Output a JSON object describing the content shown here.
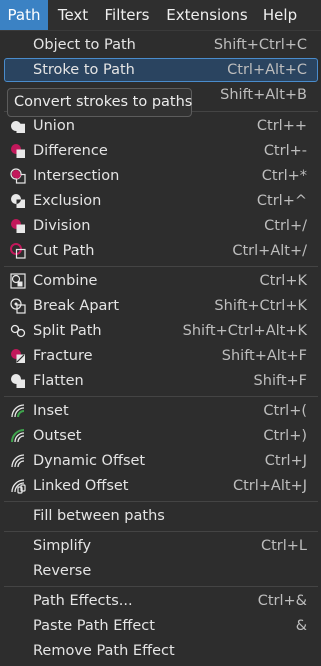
{
  "menubar": {
    "items": [
      "Path",
      "Text",
      "Filters",
      "Extensions",
      "Help"
    ]
  },
  "tooltip": "Convert strokes to paths",
  "menu": {
    "items": [
      {
        "label": "Object to Path",
        "shortcut": "Shift+Ctrl+C",
        "icon": "none"
      },
      {
        "label": "Stroke to Path",
        "shortcut": "Ctrl+Alt+C",
        "icon": "none"
      },
      {
        "label": "",
        "shortcut": "Shift+Alt+B",
        "icon": "none"
      },
      {
        "label": "Union",
        "shortcut": "Ctrl++",
        "icon": "union-icon"
      },
      {
        "label": "Difference",
        "shortcut": "Ctrl+-",
        "icon": "difference-icon"
      },
      {
        "label": "Intersection",
        "shortcut": "Ctrl+*",
        "icon": "intersection-icon"
      },
      {
        "label": "Exclusion",
        "shortcut": "Ctrl+^",
        "icon": "exclusion-icon"
      },
      {
        "label": "Division",
        "shortcut": "Ctrl+/",
        "icon": "division-icon"
      },
      {
        "label": "Cut Path",
        "shortcut": "Ctrl+Alt+/",
        "icon": "cut-path-icon"
      },
      {
        "label": "Combine",
        "shortcut": "Ctrl+K",
        "icon": "combine-icon"
      },
      {
        "label": "Break Apart",
        "shortcut": "Shift+Ctrl+K",
        "icon": "break-apart-icon"
      },
      {
        "label": "Split Path",
        "shortcut": "Shift+Ctrl+Alt+K",
        "icon": "split-path-icon"
      },
      {
        "label": "Fracture",
        "shortcut": "Shift+Alt+F",
        "icon": "fracture-icon"
      },
      {
        "label": "Flatten",
        "shortcut": "Shift+F",
        "icon": "flatten-icon"
      },
      {
        "label": "Inset",
        "shortcut": "Ctrl+(",
        "icon": "inset-icon"
      },
      {
        "label": "Outset",
        "shortcut": "Ctrl+)",
        "icon": "outset-icon"
      },
      {
        "label": "Dynamic Offset",
        "shortcut": "Ctrl+J",
        "icon": "dynamic-offset-icon"
      },
      {
        "label": "Linked Offset",
        "shortcut": "Ctrl+Alt+J",
        "icon": "linked-offset-icon"
      },
      {
        "label": "Fill between paths",
        "shortcut": "",
        "icon": "none"
      },
      {
        "label": "Simplify",
        "shortcut": "Ctrl+L",
        "icon": "none"
      },
      {
        "label": "Reverse",
        "shortcut": "",
        "icon": "none"
      },
      {
        "label": "Path Effects...",
        "shortcut": "Ctrl+&",
        "icon": "none"
      },
      {
        "label": "Paste Path Effect",
        "shortcut": "&",
        "icon": "none"
      },
      {
        "label": "Remove Path Effect",
        "shortcut": "",
        "icon": "none"
      }
    ]
  },
  "colors": {
    "accent": "#3b82c4",
    "highlight_border": "#4a8ccc",
    "icon_magenta": "#c2185b",
    "icon_green": "#3fa34d"
  }
}
